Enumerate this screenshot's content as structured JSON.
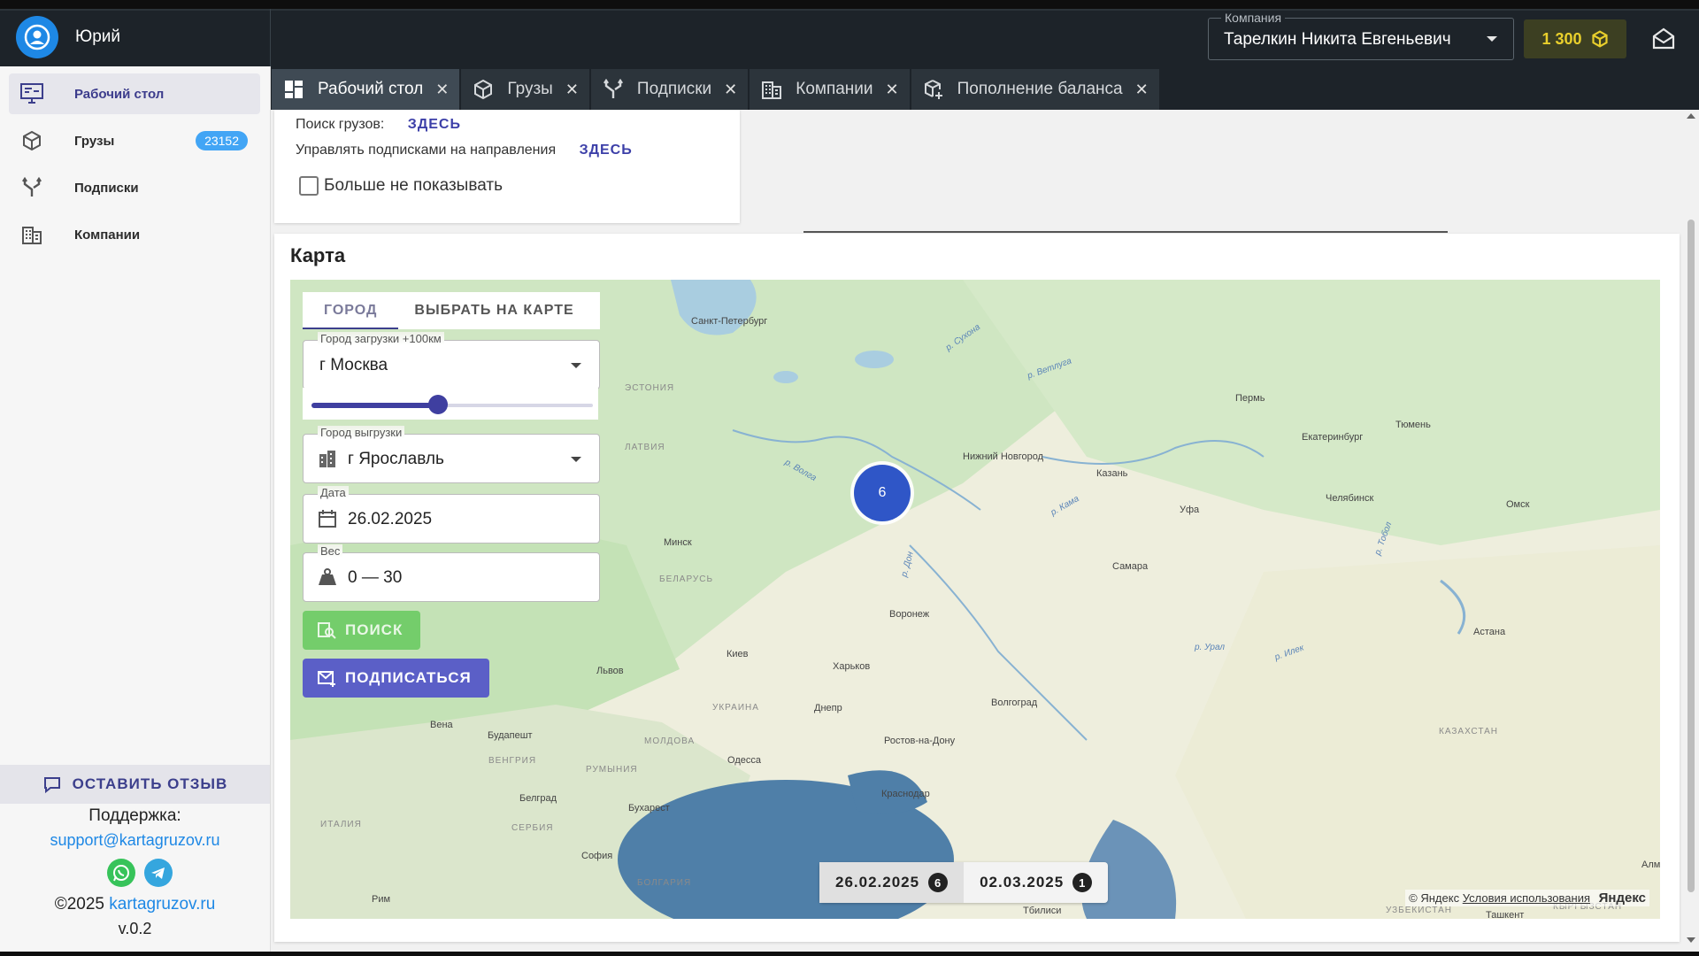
{
  "header": {
    "user_name": "Юрий",
    "tabs": [
      {
        "label": "Рабочий стол",
        "icon": "dashboard-icon",
        "active": true
      },
      {
        "label": "Грузы",
        "icon": "box-icon"
      },
      {
        "label": "Подписки",
        "icon": "fork-icon"
      },
      {
        "label": "Компании",
        "icon": "building-icon"
      },
      {
        "label": "Пополнение баланса",
        "icon": "box-plus-icon"
      }
    ],
    "company_legend": "Компания",
    "company_value": "Тарелкин Никита Евгеньевич",
    "balance": "1 300"
  },
  "sidebar": {
    "items": [
      {
        "label": "Рабочий стол",
        "icon": "monitor-icon",
        "active": true
      },
      {
        "label": "Грузы",
        "icon": "box-icon",
        "badge": "23152"
      },
      {
        "label": "Подписки",
        "icon": "fork-icon"
      },
      {
        "label": "Компании",
        "icon": "building-icon"
      }
    ],
    "feedback_label": "ОСТАВИТЬ ОТЗЫВ",
    "support_title": "Поддержка:",
    "support_email": "support@kartagruzov.ru",
    "copyright_prefix": "©2025",
    "copyright_link": "kartagruzov.ru",
    "version": "v.0.2"
  },
  "info": {
    "search_label": "Поиск грузов:",
    "search_link": "ЗДЕСЬ",
    "subs_label": "Управлять подписками на направления",
    "subs_link": "ЗДЕСЬ",
    "dont_show_label": "Больше не показывать",
    "dont_show_checked": false
  },
  "map_section": {
    "title": "Карта",
    "tabs": [
      "ГОРОД",
      "ВЫБРАТЬ НА КАРТЕ"
    ],
    "load_city_legend": "Город загрузки +100км",
    "load_city_value": "г Москва",
    "radius_slider_fraction": 0.45,
    "unload_city_legend": "Город выгрузки",
    "unload_city_value": "г Ярославль",
    "date_legend": "Дата",
    "date_value": "26.02.2025",
    "weight_legend": "Вес",
    "weight_value": "0 — 30",
    "search_button": "ПОИСК",
    "subscribe_button": "ПОДПИСАТЬСЯ",
    "cluster_count": "6",
    "date_chips": [
      {
        "date": "26.02.2025",
        "count": "6",
        "active": true
      },
      {
        "date": "02.03.2025",
        "count": "1"
      }
    ],
    "attribution": "© Яндекс",
    "terms_link": "Условия использования",
    "yandex_logo": "Яндекс",
    "labels": {
      "spb": "Санкт-Петербург",
      "perm": "Пермь",
      "tyumen": "Тюмень",
      "ekb": "Екатеринбург",
      "nn": "Нижний Новгород",
      "kazan": "Казань",
      "ufa": "Уфа",
      "chel": "Челябинск",
      "omsk": "Омск",
      "minsk": "Минск",
      "samara": "Самара",
      "voronezh": "Воронеж",
      "kiev": "Киев",
      "kharkov": "Харьков",
      "lvov": "Львов",
      "dnepr": "Днепр",
      "volgograd": "Волгоград",
      "rostov": "Ростов-на-Дону",
      "astana": "Астана",
      "krasnodar": "Краснодар",
      "odessa": "Одесса",
      "budapest": "Будапешт",
      "vena": "Вена",
      "bucharest": "Бухарест",
      "belgrad": "Белград",
      "sofia": "София",
      "rim": "Рим",
      "belarus": "БЕЛАРУСЬ",
      "ukraine": "УКРАИНА",
      "moldova": "МОЛДОВА",
      "romania": "РУМЫНИЯ",
      "hungary": "ВЕНГРИЯ",
      "serbia": "СЕРБИЯ",
      "bulgaria": "БОЛГАРИЯ",
      "italy": "ИТАЛИЯ",
      "kazakhstan": "КАЗАХСТАН",
      "latvia": "ЛАТВИЯ",
      "estonia": "ЭСТОНИЯ",
      "uzbekistan": "УЗБЕКИСТАН",
      "kyrgyzstan": "КЫРГЫЗСТАН",
      "tashkent": "Ташкент",
      "tbilisi": "Тбилиси",
      "alm": "Алм",
      "r_volga": "р. Волга",
      "r_don": "р. Дон",
      "r_kama": "р. Кама",
      "r_ural": "р. Урал",
      "r_sukhona": "р. Сухона",
      "r_vetluga": "р. Ветлуга",
      "r_tobol": "р. Тобол",
      "r_ilek": "р. Илек"
    }
  },
  "colors": {
    "accent": "#3c3f8c",
    "link": "#1e88e5",
    "badge": "#42a5f5",
    "balance_text": "#e9cf2c",
    "cluster": "#2f56c7",
    "search_btn": "#74cd6b",
    "subscribe_btn": "#5b5fc7"
  }
}
